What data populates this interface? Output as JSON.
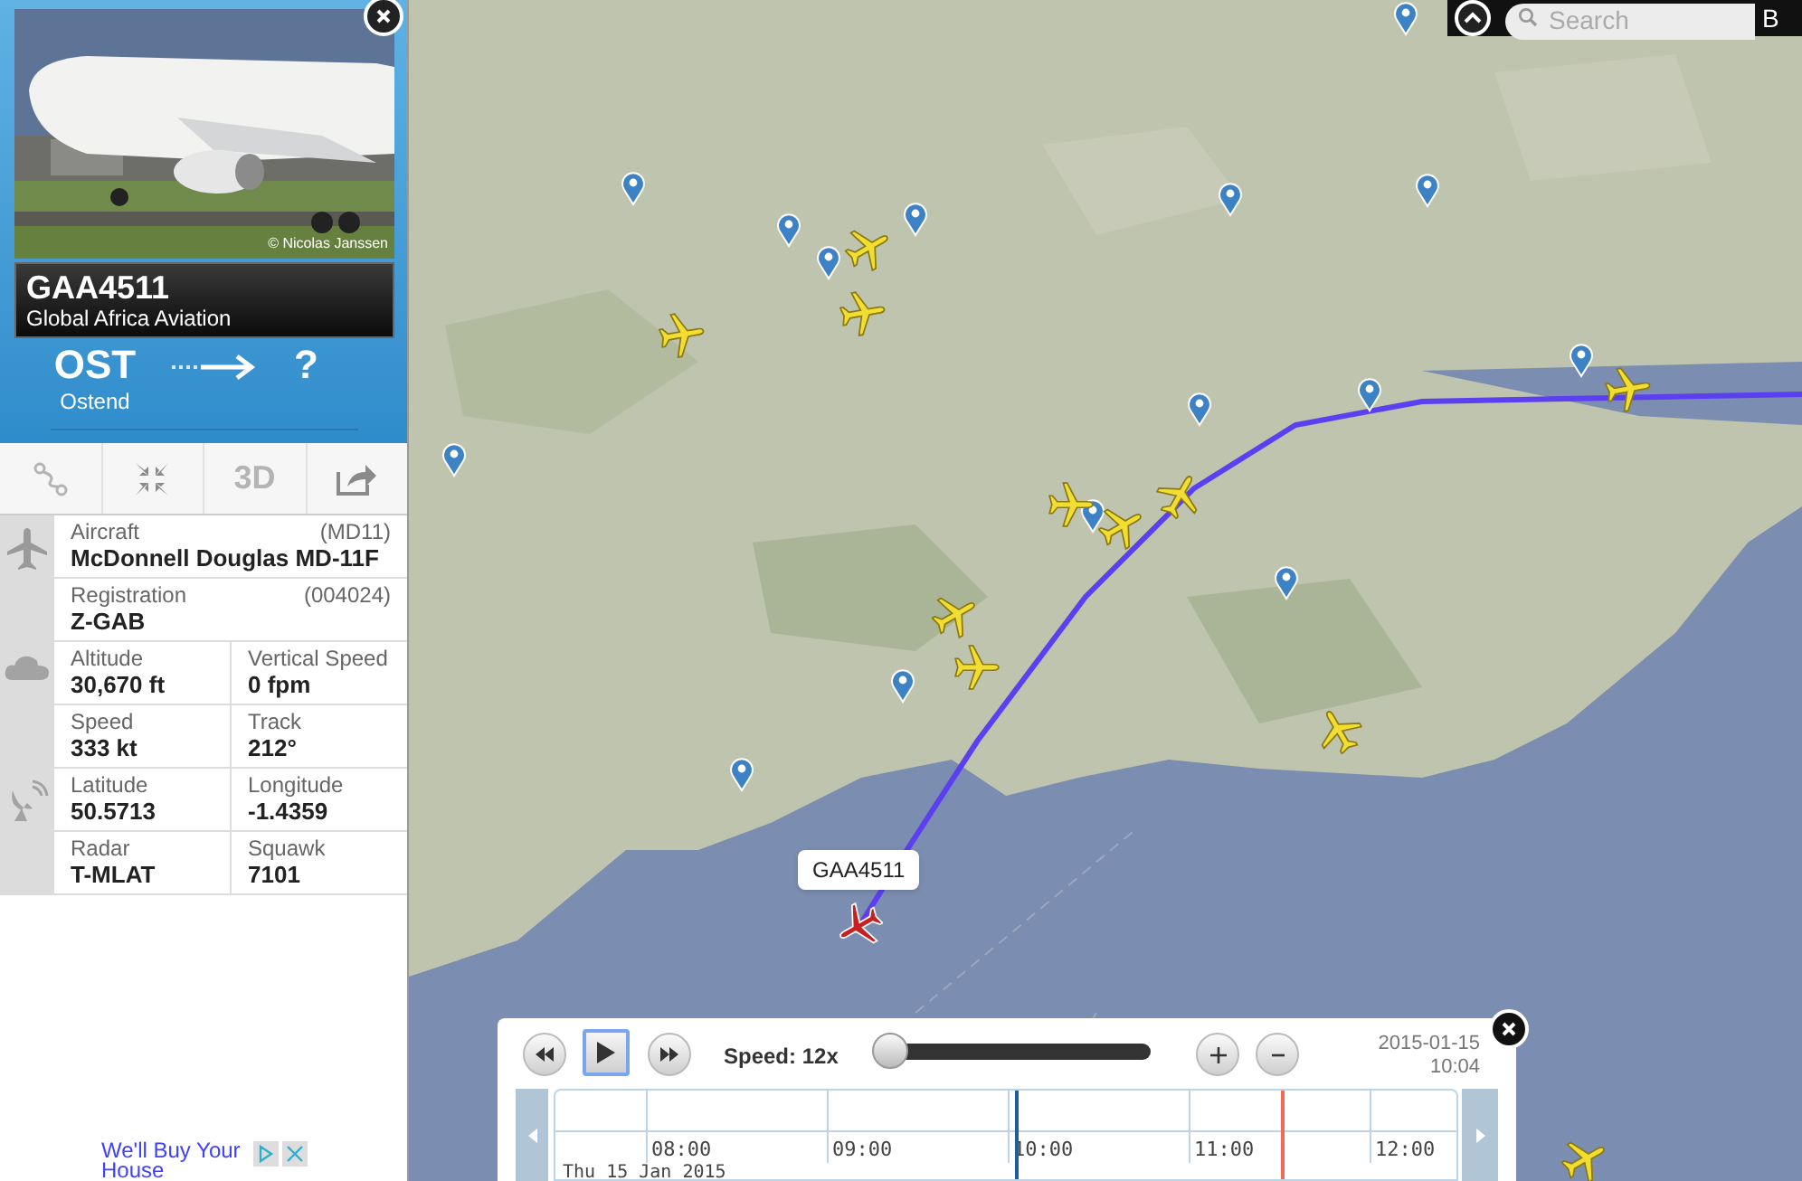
{
  "photo": {
    "credit": "© Nicolas Janssen"
  },
  "flight": {
    "callsign": "GAA4511",
    "airline": "Global Africa Aviation"
  },
  "route": {
    "origin_code": "OST",
    "origin_name": "Ostend",
    "destination_code": "?"
  },
  "toolbar": [
    {
      "kind": "route",
      "disabled": true
    },
    {
      "kind": "center",
      "disabled": false
    },
    {
      "kind": "perspective",
      "label": "3D",
      "disabled": true
    },
    {
      "kind": "share",
      "disabled": false
    }
  ],
  "details": [
    {
      "rows": [
        [
          {
            "label": "Aircraft",
            "extra": "(MD11)",
            "value": "McDonnell Douglas MD-11F"
          }
        ],
        [
          {
            "label": "Registration",
            "extra": "(004024)",
            "value": "Z-GAB"
          }
        ]
      ]
    },
    {
      "rows": [
        [
          {
            "label": "Altitude",
            "value": "30,670 ft"
          },
          {
            "label": "Vertical Speed",
            "value": "0 fpm"
          }
        ],
        [
          {
            "label": "Speed",
            "value": "333 kt"
          },
          {
            "label": "Track",
            "value": "212°"
          }
        ]
      ]
    },
    {
      "rows": [
        [
          {
            "label": "Latitude",
            "value": "50.5713"
          },
          {
            "label": "Longitude",
            "value": "-1.4359"
          }
        ],
        [
          {
            "label": "Radar",
            "value": "T-MLAT"
          },
          {
            "label": "Squawk",
            "value": "7101"
          }
        ]
      ]
    }
  ],
  "ad": {
    "text": "We'll Buy Your House"
  },
  "map": {
    "search_placeholder": "Search",
    "corner_button": "B",
    "callout": "GAA4511",
    "aircraft_markers": [
      {
        "selected": false
      },
      {
        "selected": false
      },
      {
        "selected": false
      },
      {
        "selected": false
      },
      {
        "selected": false
      },
      {
        "selected": false
      },
      {
        "selected": false
      },
      {
        "selected": false
      },
      {
        "selected": false
      },
      {
        "selected": false
      },
      {
        "selected": false
      },
      {
        "selected": true
      }
    ]
  },
  "playback": {
    "speed": "Speed: 12x",
    "level": 0.0,
    "date": "2015-01-15",
    "time": "10:04",
    "ticks": [
      "08:00",
      "09:00",
      "10:00",
      "11:00",
      "12:00"
    ],
    "day": "Thu 15 Jan 2015"
  }
}
